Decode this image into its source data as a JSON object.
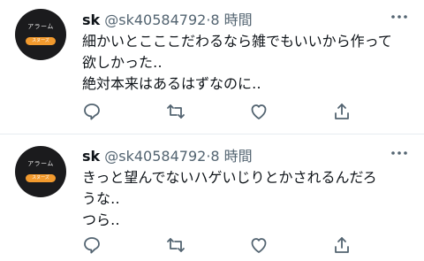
{
  "tweets": [
    {
      "avatar": {
        "title": "アラーム",
        "button": "スヌーズ"
      },
      "name": "sk",
      "handle": "@sk40584792",
      "separator": "·",
      "time": "8 時間",
      "lines": [
        "細かいとこここだわるなら雑でもいいから作って",
        "欲しかった‥",
        "絶対本来はあるはずなのに‥"
      ]
    },
    {
      "avatar": {
        "title": "アラーム",
        "button": "スヌーズ"
      },
      "name": "sk",
      "handle": "@sk40584792",
      "separator": "·",
      "time": "8 時間",
      "lines": [
        "きっと望んでないハゲいじりとかされるんだろ",
        "うな‥",
        "つら‥"
      ]
    }
  ],
  "icons": {
    "color": "#536471",
    "avatar_bg": "#1b1b1d",
    "avatar_button": "#f29a2e"
  }
}
